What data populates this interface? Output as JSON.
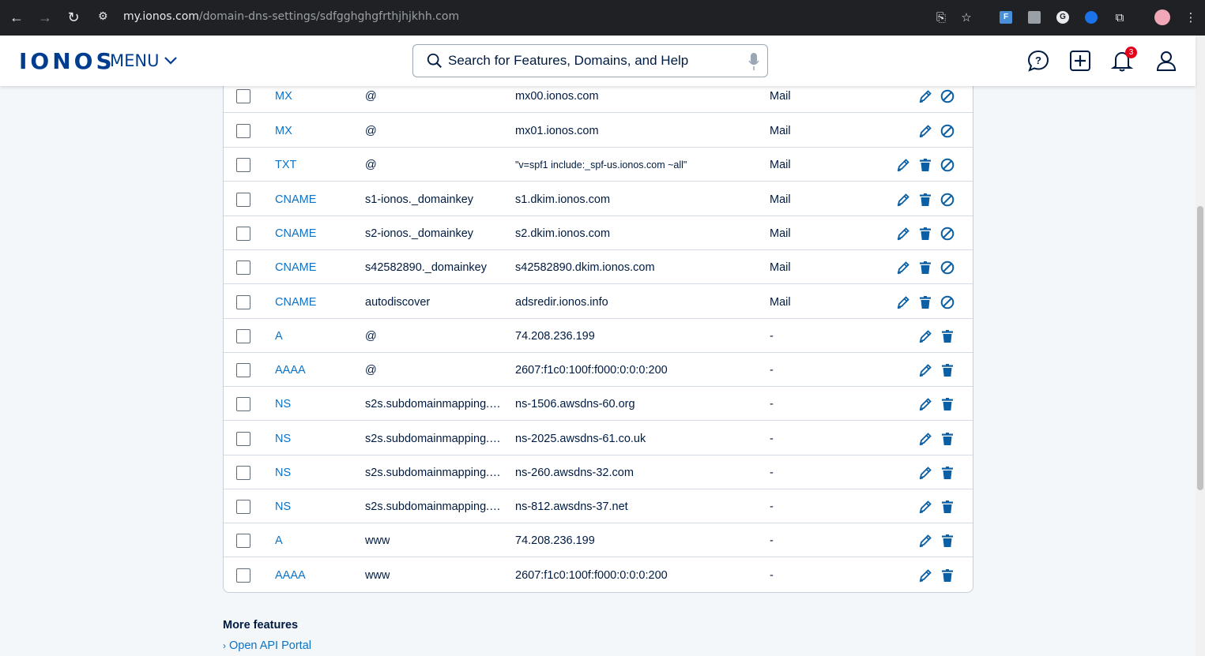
{
  "browser": {
    "url_domain": "my.ionos.com",
    "url_path": "/domain-dns-settings/sdfgghghgfrthjhjkhh.com"
  },
  "header": {
    "logo": "IONOS",
    "menu_label": "MENU",
    "search_placeholder": "Search for Features, Domains, and Help",
    "notification_count": "3"
  },
  "records": [
    {
      "type": "MX",
      "host": "@",
      "value": "mx00.ionos.com",
      "service": "Mail",
      "actions": [
        "edit",
        "disable"
      ]
    },
    {
      "type": "MX",
      "host": "@",
      "value": "mx01.ionos.com",
      "service": "Mail",
      "actions": [
        "edit",
        "disable"
      ]
    },
    {
      "type": "TXT",
      "host": "@",
      "value": "\"v=spf1 include:_spf-us.ionos.com ~all\"",
      "service": "Mail",
      "actions": [
        "edit",
        "delete",
        "disable"
      ]
    },
    {
      "type": "CNAME",
      "host": "s1-ionos._domainkey",
      "value": "s1.dkim.ionos.com",
      "service": "Mail",
      "actions": [
        "edit",
        "delete",
        "disable"
      ]
    },
    {
      "type": "CNAME",
      "host": "s2-ionos._domainkey",
      "value": "s2.dkim.ionos.com",
      "service": "Mail",
      "actions": [
        "edit",
        "delete",
        "disable"
      ]
    },
    {
      "type": "CNAME",
      "host": "s42582890._domainkey",
      "value": "s42582890.dkim.ionos.com",
      "service": "Mail",
      "actions": [
        "edit",
        "delete",
        "disable"
      ]
    },
    {
      "type": "CNAME",
      "host": "autodiscover",
      "value": "adsredir.ionos.info",
      "service": "Mail",
      "actions": [
        "edit",
        "delete",
        "disable"
      ]
    },
    {
      "type": "A",
      "host": "@",
      "value": "74.208.236.199",
      "service": "-",
      "actions": [
        "edit",
        "delete"
      ]
    },
    {
      "type": "AAAA",
      "host": "@",
      "value": "2607:f1c0:100f:f000:0:0:0:200",
      "service": "-",
      "actions": [
        "edit",
        "delete"
      ]
    },
    {
      "type": "NS",
      "host": "s2s.subdomainmapping.…",
      "value": "ns-1506.awsdns-60.org",
      "service": "-",
      "actions": [
        "edit",
        "delete"
      ]
    },
    {
      "type": "NS",
      "host": "s2s.subdomainmapping.…",
      "value": "ns-2025.awsdns-61.co.uk",
      "service": "-",
      "actions": [
        "edit",
        "delete"
      ]
    },
    {
      "type": "NS",
      "host": "s2s.subdomainmapping.…",
      "value": "ns-260.awsdns-32.com",
      "service": "-",
      "actions": [
        "edit",
        "delete"
      ]
    },
    {
      "type": "NS",
      "host": "s2s.subdomainmapping.…",
      "value": "ns-812.awsdns-37.net",
      "service": "-",
      "actions": [
        "edit",
        "delete"
      ]
    },
    {
      "type": "A",
      "host": "www",
      "value": "74.208.236.199",
      "service": "-",
      "actions": [
        "edit",
        "delete"
      ]
    },
    {
      "type": "AAAA",
      "host": "www",
      "value": "2607:f1c0:100f:f000:0:0:0:200",
      "service": "-",
      "actions": [
        "edit",
        "delete"
      ]
    }
  ],
  "more_features": {
    "title": "More features",
    "link": "Open API Portal"
  },
  "colors": {
    "brand": "#003d8f",
    "link": "#0b72c7",
    "action_icon": "#0b5fa5"
  }
}
